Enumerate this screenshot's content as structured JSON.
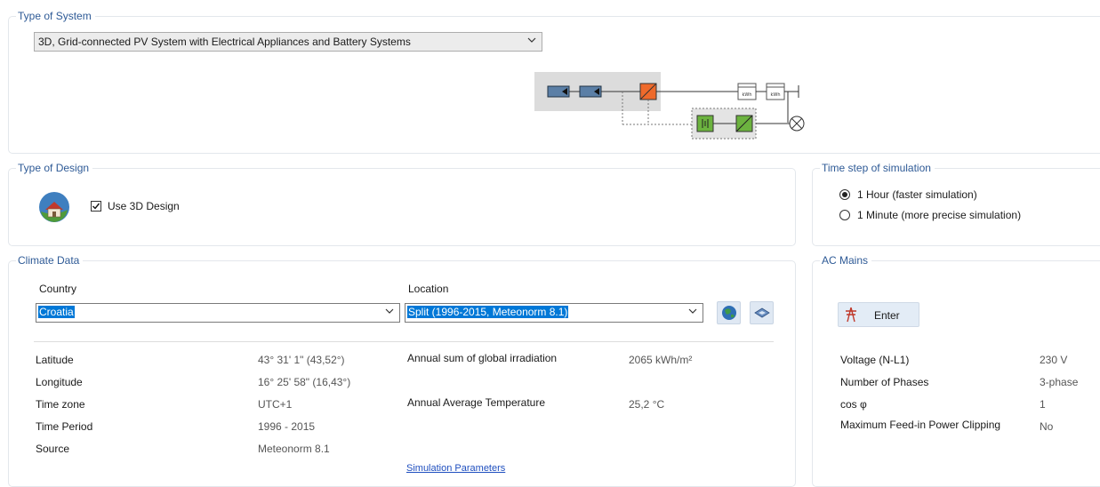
{
  "system": {
    "title": "Type of System",
    "selected": "3D, Grid-connected PV System with Electrical Appliances and Battery Systems",
    "diagram_meter_label": "kWh"
  },
  "design": {
    "title": "Type of Design",
    "use3d_label": "Use 3D Design",
    "use3d_checked": true
  },
  "timestep": {
    "title": "Time step of simulation",
    "option_hour": "1 Hour (faster simulation)",
    "option_minute": "1 Minute (more precise simulation)",
    "selected": "hour"
  },
  "climate": {
    "title": "Climate Data",
    "country_label": "Country",
    "country_value": "Croatia",
    "location_label": "Location",
    "location_value": "Split (1996-2015, Meteonorm 8.1)",
    "rows": [
      {
        "label": "Latitude",
        "value": "43° 31' 1\"  (43,52°)"
      },
      {
        "label": "Longitude",
        "value": "16° 25' 58\"  (16,43°)"
      },
      {
        "label": "Time zone",
        "value": "UTC+1"
      },
      {
        "label": "Time Period",
        "value": "1996 - 2015"
      },
      {
        "label": "Source",
        "value": "Meteonorm 8.1"
      }
    ],
    "irradiation_label": "Annual sum of global irradiation",
    "irradiation_value": "2065 kWh/m²",
    "temperature_label": "Annual Average Temperature",
    "temperature_value": "25,2 °C",
    "sim_params_link": "Simulation Parameters"
  },
  "ac": {
    "title": "AC Mains",
    "enter_label": "Enter",
    "rows": [
      {
        "label": "Voltage (N-L1)",
        "value": "230 V"
      },
      {
        "label": "Number of Phases",
        "value": "3-phase"
      },
      {
        "label": "cos φ",
        "value": "1"
      },
      {
        "label": "Maximum Feed-in Power Clipping",
        "value": "No"
      }
    ]
  },
  "colors": {
    "group_title": "#2e5a96",
    "selection": "#0078d7",
    "pv_module": "#5b7fa6",
    "inverter": "#ef6a2b",
    "battery": "#6cb33f"
  },
  "icons": [
    "chevron-down-icon",
    "house-globe-icon",
    "checkbox-check-icon",
    "globe-icon",
    "map-icon",
    "power-pylon-icon",
    "lamp-load-icon",
    "kwh-meter-icon"
  ]
}
